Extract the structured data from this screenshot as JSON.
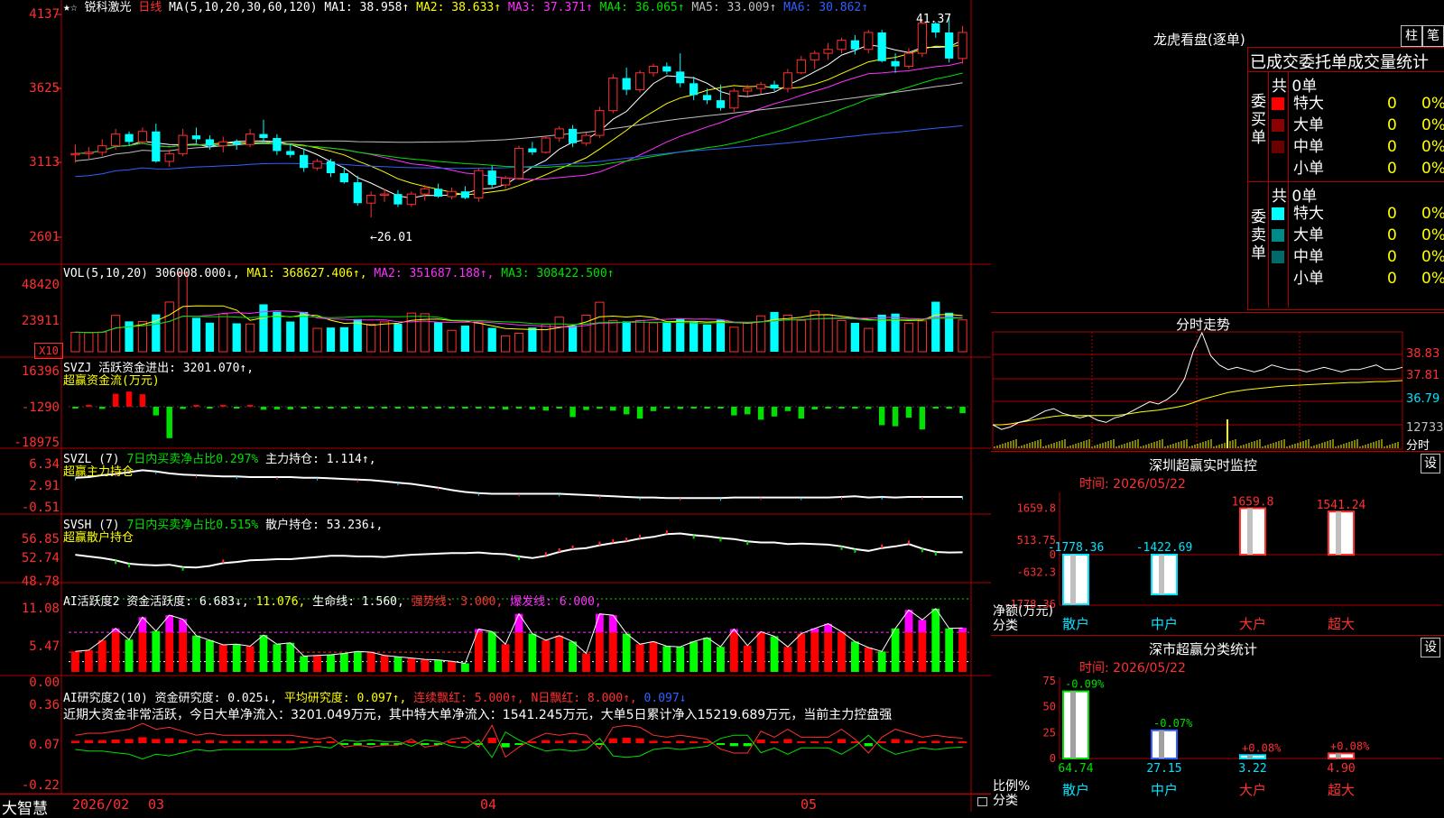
{
  "app_name": "大智慧",
  "title_bar": {
    "stock_name": "锐科激光",
    "period": "日线",
    "ma_label": "MA(5,10,20,30,60,120)",
    "ma_values": [
      {
        "label": "MA1:",
        "value": "38.958↑",
        "color": "#ffffff"
      },
      {
        "label": "MA2:",
        "value": "38.633↑",
        "color": "#ffff00"
      },
      {
        "label": "MA3:",
        "value": "37.371↑",
        "color": "#ff30ff"
      },
      {
        "label": "MA4:",
        "value": "36.065↑",
        "color": "#00e000"
      },
      {
        "label": "MA5:",
        "value": "33.009↑",
        "color": "#c0c0c0"
      },
      {
        "label": "MA6:",
        "value": "30.862↑",
        "color": "#3060ff"
      }
    ]
  },
  "price_axis": [
    "4137",
    "3625",
    "3113",
    "2601"
  ],
  "annotations": {
    "high": "41.37",
    "low": "←26.01"
  },
  "vol_panel": {
    "header": "VOL(5,10,20)",
    "value": "306008.000↓,",
    "ma1": "MA1: 368627.406↑,",
    "ma2": "MA2: 351687.188↑,",
    "ma3": "MA3: 308422.500↑",
    "axis": [
      "48420",
      "23911"
    ],
    "multiplier": "X10"
  },
  "svzj_panel": {
    "header": "SVZJ  活跃资金进出: 3201.070↑,",
    "subtitle": "超赢资金流(万元)",
    "axis": [
      "16396",
      "-1290",
      "-18975"
    ]
  },
  "svzl_panel": {
    "header1": "SVZL (7) ",
    "header2": "7日内买卖净占比0.297%",
    "header3": " 主力持仓: 1.114↑,",
    "subtitle": "超赢主力持仓",
    "axis": [
      "6.34",
      "2.91",
      "-0.51"
    ]
  },
  "svsh_panel": {
    "header1": "SVSH (7) ",
    "header2": "7日内买卖净占比0.515%",
    "header3": " 散户持仓: 53.236↓,",
    "subtitle": "超赢散户持仓",
    "axis": [
      "56.85",
      "52.74",
      "48.78"
    ]
  },
  "ai_panel": {
    "h1": "AI活跃度2 资金活跃度: 6.683↓,",
    "h2": " 11.076,",
    "h3": " 生命线: 1.560,",
    "h4": " 强势线: 3.000,",
    "h5": " 爆发线: 6.000,",
    "axis": [
      "11.08",
      "5.47",
      "0.00"
    ]
  },
  "ai2_panel": {
    "h1": "AI研究度2(10) 资金研究度: 0.025↓,",
    "h2": " 平均研究度: 0.097↑,",
    "h3": " 连续飘红: 5.000↑,",
    "h4": " N日飘红: 8.000↑,",
    "h5": " 0.097↓",
    "note": "近期大资金非常活跃，今日大单净流入：3201.049万元，其中特大单净流入：1541.245万元，大单5日累计净入15219.689万元，当前主力控盘强",
    "axis": [
      "0.36",
      "0.07",
      "-0.22"
    ]
  },
  "date_axis": [
    "2026/02",
    "03",
    "04",
    "05"
  ],
  "chart_data": {
    "type": "candlestick",
    "title": "锐科激光 日线",
    "ylabel": "",
    "ylim": [
      24.0,
      42.0
    ],
    "candles": [
      [
        30.8,
        31.6,
        30.2,
        30.9
      ],
      [
        30.9,
        31.4,
        30.5,
        31.0
      ],
      [
        31.0,
        32.0,
        30.7,
        31.5
      ],
      [
        31.5,
        32.8,
        31.2,
        32.4
      ],
      [
        32.4,
        32.6,
        31.5,
        31.8
      ],
      [
        31.8,
        32.9,
        31.6,
        32.6
      ],
      [
        32.6,
        33.2,
        30.2,
        30.3
      ],
      [
        30.3,
        31.2,
        29.9,
        30.9
      ],
      [
        30.9,
        32.8,
        30.7,
        32.3
      ],
      [
        32.3,
        32.9,
        31.7,
        32.0
      ],
      [
        32.0,
        32.3,
        31.2,
        31.5
      ],
      [
        31.5,
        32.2,
        31.0,
        31.8
      ],
      [
        31.8,
        32.0,
        31.2,
        31.6
      ],
      [
        31.6,
        32.8,
        31.4,
        32.4
      ],
      [
        32.4,
        33.5,
        31.8,
        32.1
      ],
      [
        32.1,
        32.4,
        30.8,
        31.1
      ],
      [
        31.1,
        31.7,
        30.6,
        30.8
      ],
      [
        30.8,
        31.3,
        29.5,
        29.8
      ],
      [
        29.8,
        30.5,
        29.6,
        30.3
      ],
      [
        30.3,
        30.5,
        29.1,
        29.4
      ],
      [
        29.4,
        29.8,
        28.6,
        28.7
      ],
      [
        28.7,
        29.2,
        26.9,
        27.1
      ],
      [
        27.1,
        28.0,
        26.0,
        27.7
      ],
      [
        27.7,
        28.2,
        27.2,
        27.8
      ],
      [
        27.8,
        28.1,
        26.8,
        27.0
      ],
      [
        27.0,
        28.0,
        26.8,
        27.8
      ],
      [
        27.8,
        28.5,
        27.3,
        28.2
      ],
      [
        28.2,
        28.6,
        27.5,
        27.6
      ],
      [
        27.6,
        28.3,
        27.4,
        28.0
      ],
      [
        28.0,
        28.4,
        27.4,
        27.5
      ],
      [
        27.5,
        29.8,
        27.2,
        29.6
      ],
      [
        29.6,
        30.0,
        28.3,
        28.5
      ],
      [
        28.5,
        29.2,
        28.2,
        29.0
      ],
      [
        29.0,
        31.5,
        28.9,
        31.3
      ],
      [
        31.3,
        31.8,
        30.8,
        31.0
      ],
      [
        31.0,
        32.3,
        30.9,
        32.1
      ],
      [
        32.1,
        33.0,
        31.8,
        32.8
      ],
      [
        32.8,
        33.1,
        31.4,
        31.7
      ],
      [
        31.7,
        32.5,
        31.5,
        32.3
      ],
      [
        32.3,
        34.5,
        32.1,
        34.2
      ],
      [
        34.2,
        37.0,
        34.0,
        36.7
      ],
      [
        36.7,
        37.5,
        35.4,
        35.8
      ],
      [
        35.8,
        37.3,
        35.6,
        37.1
      ],
      [
        37.1,
        37.8,
        36.8,
        37.6
      ],
      [
        37.6,
        37.9,
        37.0,
        37.2
      ],
      [
        37.2,
        38.6,
        36.0,
        36.3
      ],
      [
        36.3,
        36.8,
        35.0,
        35.4
      ],
      [
        35.4,
        35.9,
        34.7,
        35.0
      ],
      [
        35.0,
        36.2,
        34.2,
        34.4
      ],
      [
        34.4,
        35.9,
        34.1,
        35.7
      ],
      [
        35.7,
        36.2,
        35.3,
        35.9
      ],
      [
        35.9,
        36.4,
        35.5,
        36.2
      ],
      [
        36.2,
        36.5,
        35.7,
        35.9
      ],
      [
        35.9,
        37.4,
        35.6,
        37.1
      ],
      [
        37.1,
        38.4,
        37.0,
        38.1
      ],
      [
        38.1,
        38.8,
        37.4,
        38.6
      ],
      [
        38.6,
        39.4,
        38.1,
        38.9
      ],
      [
        38.9,
        39.8,
        38.6,
        39.6
      ],
      [
        39.6,
        40.0,
        38.5,
        38.9
      ],
      [
        38.9,
        40.4,
        38.6,
        40.2
      ],
      [
        40.2,
        40.4,
        37.9,
        38.0
      ],
      [
        38.0,
        38.6,
        37.1,
        37.6
      ],
      [
        37.6,
        39.0,
        37.4,
        38.6
      ],
      [
        38.6,
        41.2,
        38.3,
        40.9
      ],
      [
        40.9,
        41.0,
        39.8,
        40.2
      ],
      [
        40.2,
        41.37,
        37.9,
        38.2
      ],
      [
        38.2,
        40.7,
        37.8,
        40.2
      ]
    ],
    "ma_lines": [
      {
        "name": "MA1",
        "color": "#ffffff"
      },
      {
        "name": "MA2",
        "color": "#ffff00"
      },
      {
        "name": "MA3",
        "color": "#ff30ff"
      },
      {
        "name": "MA4",
        "color": "#00e000"
      },
      {
        "name": "MA5",
        "color": "#c0c0c0"
      },
      {
        "name": "MA6",
        "color": "#3060ff"
      }
    ],
    "volume": [
      120,
      118,
      121,
      224,
      187,
      186,
      230,
      306,
      484,
      209,
      179,
      233,
      175,
      171,
      292,
      246,
      186,
      245,
      144,
      149,
      151,
      201,
      169,
      184,
      172,
      238,
      234,
      181,
      132,
      161,
      176,
      147,
      98,
      114,
      149,
      170,
      213,
      161,
      225,
      305,
      192,
      187,
      192,
      178,
      178,
      205,
      184,
      168,
      196,
      151,
      180,
      221,
      245,
      225,
      193,
      251,
      227,
      192,
      178,
      144,
      228,
      235,
      176,
      190,
      308,
      240,
      196
    ],
    "svzj": [
      -50,
      170,
      -200,
      1200,
      1400,
      1150,
      -800,
      -2900,
      -200,
      100,
      -150,
      140,
      -100,
      120,
      -280,
      -240,
      -240,
      -120,
      -90,
      -130,
      -120,
      -100,
      -130,
      -100,
      -80,
      -100,
      -150,
      -130,
      -80,
      -150,
      -160,
      -150,
      -260,
      -170,
      -250,
      -350,
      -100,
      -950,
      -300,
      -180,
      -360,
      -700,
      -1100,
      -400,
      -120,
      -200,
      -150,
      -170,
      -150,
      -800,
      -700,
      -1200,
      -900,
      -400,
      -1100,
      -250,
      -170,
      -150,
      -170,
      -200,
      -1700,
      -1800,
      -1000,
      -2100,
      -150,
      -180,
      -600
    ],
    "mainhold": [
      4.2,
      4.3,
      4.6,
      4.8,
      5.1,
      5.4,
      5.2,
      4.9,
      4.7,
      4.6,
      4.5,
      4.4,
      4.4,
      4.3,
      4.3,
      4.3,
      4.3,
      4.2,
      4.2,
      4.1,
      4.0,
      3.9,
      3.8,
      3.6,
      3.4,
      3.2,
      2.9,
      2.6,
      2.2,
      1.9,
      1.7,
      1.6,
      1.6,
      1.6,
      1.6,
      1.6,
      1.6,
      1.5,
      1.4,
      1.3,
      1.2,
      1.1,
      1.0,
      1.0,
      0.9,
      0.9,
      0.9,
      0.9,
      0.9,
      1.0,
      1.0,
      1.0,
      1.0,
      1.0,
      1.0,
      1.0,
      1.0,
      1.1,
      1.2,
      1.0,
      1.1,
      1.0,
      1.1,
      1.1,
      1.1,
      1.1,
      1.1
    ],
    "retailhold": [
      52.8,
      52.5,
      52.2,
      51.8,
      51.2,
      51.0,
      50.9,
      51.0,
      50.6,
      50.5,
      50.8,
      51.3,
      51.5,
      51.8,
      51.9,
      52.0,
      52.0,
      52.2,
      52.4,
      52.6,
      52.6,
      52.5,
      52.5,
      52.4,
      52.6,
      52.8,
      52.9,
      53.0,
      53.1,
      53.1,
      53.2,
      53.0,
      52.9,
      52.5,
      52.2,
      52.6,
      53.3,
      53.8,
      54.0,
      54.5,
      54.9,
      55.2,
      55.7,
      56.0,
      56.5,
      56.6,
      56.3,
      56.1,
      55.8,
      55.6,
      55.2,
      55.0,
      55.0,
      54.7,
      54.8,
      54.7,
      54.6,
      54.3,
      53.8,
      53.5,
      54.0,
      54.3,
      54.7,
      53.9,
      53.3,
      53.2,
      53.24
    ],
    "ai_active": [
      3.1,
      3.3,
      4.8,
      6.6,
      4.9,
      8.3,
      6.2,
      8.6,
      8.0,
      5.5,
      4.8,
      4.1,
      4.2,
      3.9,
      5.6,
      4.2,
      4.4,
      2.4,
      2.5,
      2.6,
      2.8,
      3.1,
      3.0,
      2.5,
      2.3,
      2.1,
      1.9,
      1.8,
      1.6,
      1.3,
      6.5,
      6.1,
      4.2,
      8.8,
      5.8,
      4.8,
      5.5,
      4.6,
      2.8,
      8.8,
      8.6,
      5.8,
      4.2,
      4.6,
      3.9,
      3.8,
      4.6,
      5.2,
      3.8,
      6.5,
      4.0,
      6.1,
      5.4,
      3.8,
      5.8,
      6.6,
      7.3,
      6.1,
      4.6,
      3.7,
      3.1,
      6.6,
      9.4,
      7.9,
      9.6,
      6.6,
      6.68
    ],
    "ai_research": [
      0.04,
      0.05,
      0.05,
      0.06,
      0.07,
      0.1,
      0.07,
      0.08,
      0.06,
      0.04,
      0.05,
      0.04,
      0.04,
      0.04,
      0.04,
      0.04,
      0.04,
      0.03,
      0.02,
      0.03,
      -0.02,
      -0.01,
      -0.02,
      -0.01,
      -0.01,
      0.02,
      -0.02,
      -0.01,
      0.02,
      0.03,
      -0.02,
      0.09,
      -0.07,
      -0.02,
      0.02,
      0.05,
      0.04,
      0.05,
      0.04,
      -0.03,
      0.08,
      0.09,
      0.08,
      0.04,
      0.03,
      0.04,
      0.03,
      0.02,
      -0.03,
      -0.05,
      -0.05,
      0.06,
      0.03,
      0.07,
      0.03,
      0.03,
      0.03,
      0.07,
      0.02,
      -0.05,
      0.03,
      0.07,
      0.05,
      0.03,
      0.04,
      0.03,
      0.025
    ]
  },
  "right_panel": {
    "lhb_title": "龙虎看盘(逐单)",
    "btn_zhu": "柱",
    "btn_bi": "笔",
    "deal_title": "已成交委托单成交量统计",
    "buy_label": "委买单",
    "sell_label": "委卖单",
    "buy_total": "共 0单",
    "sell_total": "共 0单",
    "buy_rows": [
      {
        "name": "特大",
        "count": "0",
        "pct": "0%",
        "color": "#ff0000"
      },
      {
        "name": "大单",
        "count": "0",
        "pct": "0%",
        "color": "#8b0000"
      },
      {
        "name": "中单",
        "count": "0",
        "pct": "0%",
        "color": "#6a0000"
      },
      {
        "name": "小单",
        "count": "0",
        "pct": "0%",
        "color": ""
      }
    ],
    "sell_rows": [
      {
        "name": "特大",
        "count": "0",
        "pct": "0%",
        "color": "#00ffff"
      },
      {
        "name": "大单",
        "count": "0",
        "pct": "0%",
        "color": "#008b8b"
      },
      {
        "name": "中单",
        "count": "0",
        "pct": "0%",
        "color": "#006a6a"
      },
      {
        "name": "小单",
        "count": "0",
        "pct": "0%",
        "color": ""
      }
    ],
    "intraday_title": "分时走势",
    "intraday_axis": [
      "38.83",
      "37.81",
      "36.79",
      "12733",
      "分时"
    ],
    "intraday_line": [
      37.3,
      37.2,
      37.25,
      37.35,
      37.4,
      37.5,
      37.6,
      37.65,
      37.55,
      37.5,
      37.45,
      37.5,
      37.4,
      37.35,
      37.45,
      37.5,
      37.6,
      37.7,
      37.8,
      37.75,
      37.85,
      38.0,
      38.3,
      38.9,
      39.3,
      38.8,
      38.6,
      38.5,
      38.55,
      38.5,
      38.45,
      38.5,
      38.6,
      38.55,
      38.5,
      38.5,
      38.45,
      38.5,
      38.55,
      38.5,
      38.45,
      38.5,
      38.5,
      38.55,
      38.6,
      38.5,
      38.5,
      38.55
    ],
    "intraday_avg": [
      37.3,
      37.3,
      37.32,
      37.35,
      37.38,
      37.42,
      37.45,
      37.48,
      37.5,
      37.5,
      37.5,
      37.5,
      37.5,
      37.5,
      37.5,
      37.52,
      37.55,
      37.58,
      37.6,
      37.62,
      37.65,
      37.68,
      37.72,
      37.78,
      37.85,
      37.9,
      37.95,
      38.0,
      38.03,
      38.06,
      38.08,
      38.1,
      38.12,
      38.14,
      38.15,
      38.16,
      38.17,
      38.18,
      38.19,
      38.2,
      38.21,
      38.22,
      38.22,
      38.23,
      38.24,
      38.24,
      38.25,
      38.26
    ],
    "sz_title": "深圳超赢实时监控",
    "sz_btn": "设",
    "sz_time": "时间: 2026/05/22",
    "sz_axis": [
      "1659.8",
      "513.75",
      "0",
      "-632.3",
      "-1778.36"
    ],
    "sz_bars": [
      {
        "label": "散户",
        "value": -1778.36,
        "text": "-1778.36",
        "color": "#00e5ff"
      },
      {
        "label": "中户",
        "value": -1422.69,
        "text": "-1422.69",
        "color": "#00e5ff"
      },
      {
        "label": "大户",
        "value": 1659.8,
        "text": "1659.8",
        "color": "#ff3030"
      },
      {
        "label": "超大",
        "value": 1541.24,
        "text": "1541.24",
        "color": "#ff3030"
      }
    ],
    "sz_ylab1": "净额(万元)",
    "sz_ylab2": "分类",
    "ss_title": "深市超赢分类统计",
    "ss_btn": "设",
    "ss_time": "时间: 2026/05/22",
    "ss_axis": [
      "75",
      "50",
      "25",
      "0"
    ],
    "ss_bars": [
      {
        "label": "散户",
        "value": 64.74,
        "top": "-0.09%",
        "bottom": "64.74",
        "color": "#00e000"
      },
      {
        "label": "中户",
        "value": 27.15,
        "top": "-0.07%",
        "bottom": "27.15",
        "color": "#3060ff"
      },
      {
        "label": "大户",
        "value": 3.22,
        "top": "+0.08%",
        "bottom": "3.22",
        "color": "#00e5ff"
      },
      {
        "label": "超大",
        "value": 4.9,
        "top": "+0.08%",
        "bottom": "4.90",
        "color": "#ff3030"
      }
    ],
    "ss_ylab1": "比例%",
    "ss_ylab2": "分类"
  }
}
